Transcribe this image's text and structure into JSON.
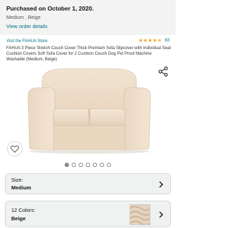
{
  "order": {
    "purchased": "Purchased on October 1, 2020.",
    "variant": "Medium , Beige",
    "view_details": "View order details"
  },
  "product": {
    "store_link": "Visit the FAHUA Store",
    "rating_stars": 4.5,
    "rating_count": "83",
    "title": "FAHUA 3 Piece Stretch Couch Cover Thick Premium Sofa Slipcover with Individual Seat Cushion Covers Soft Sofa Cover for 2 Cushion Couch Dog Pet Proof Machine Washable (Medium, Beige)"
  },
  "gallery": {
    "image_count": 7,
    "active_index": 0,
    "image_subject": "beige loveseat with slipcover"
  },
  "size_selector": {
    "label": "Size:",
    "value": "Medium"
  },
  "color_selector": {
    "label": "12 Colors:",
    "value": "Beige"
  },
  "icons": {
    "share": "share-icon",
    "wishlist": "heart-icon",
    "dropdown": "chevron-right-icon"
  },
  "colors": {
    "link": "#007185",
    "star": "#f5a623",
    "header_bg": "#f3f3f3",
    "sofa": "#eddcc8"
  }
}
